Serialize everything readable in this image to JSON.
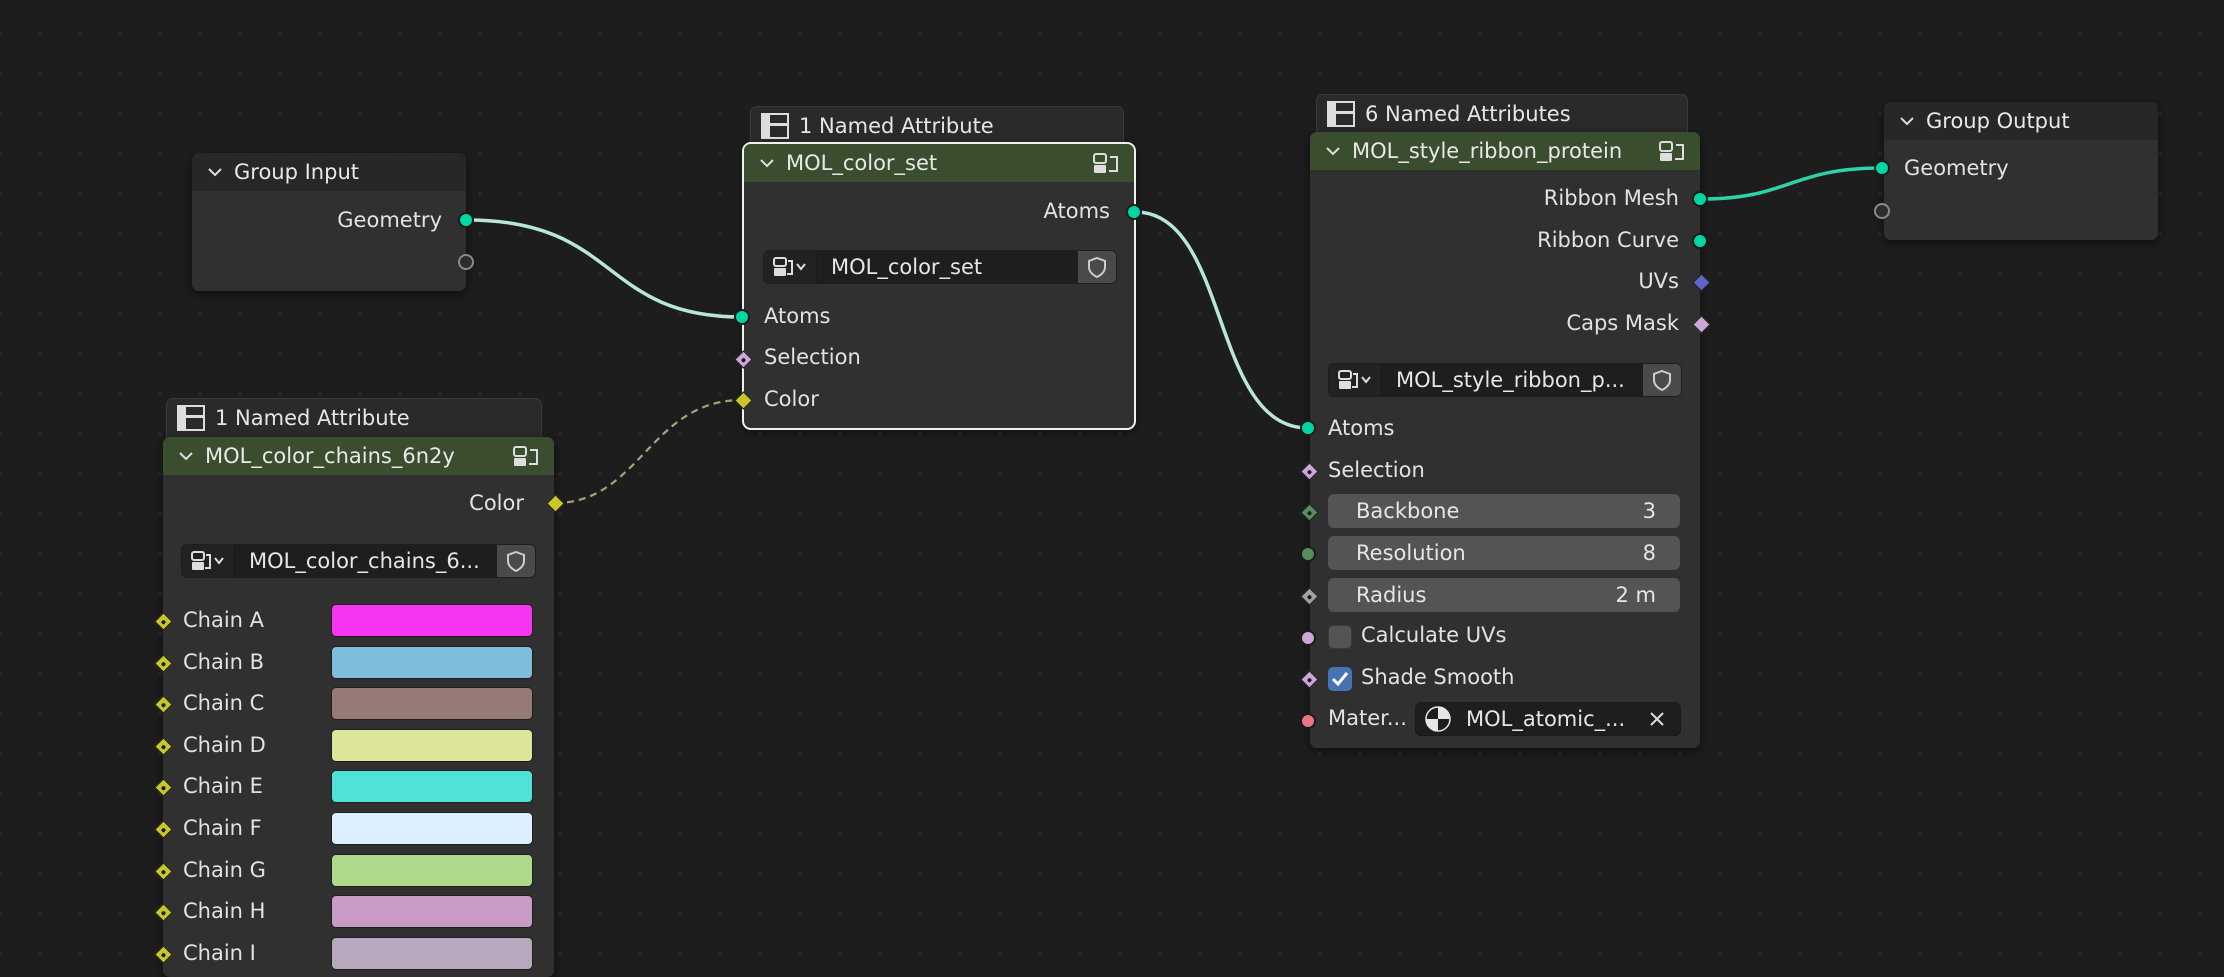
{
  "colors": {
    "background": "#1d1d1d",
    "node_body": "#303030",
    "header_green": "#3a4d2e",
    "geometry_socket": "#00d6a3",
    "color_socket": "#c7c729",
    "boolean_socket": "#cca6d6",
    "vector_socket": "#6363c7",
    "int_socket": "#598c5c",
    "float_socket": "#a1a1a1",
    "material_socket": "#eb7582",
    "checkbox_on": "#4772b3"
  },
  "group_input": {
    "title": "Group Input",
    "outputs": [
      "Geometry"
    ]
  },
  "group_output": {
    "title": "Group Output",
    "inputs": [
      "Geometry"
    ]
  },
  "color_set_frame": {
    "label": "1 Named Attribute"
  },
  "color_set": {
    "title": "MOL_color_set",
    "output": "Atoms",
    "selector_value": "MOL_color_set",
    "inputs": [
      "Atoms",
      "Selection",
      "Color"
    ]
  },
  "color_chains_frame": {
    "label": "1 Named Attribute"
  },
  "color_chains": {
    "title": "MOL_color_chains_6n2y",
    "output": "Color",
    "selector_value": "MOL_color_chains_6...",
    "chains": [
      {
        "label": "Chain A",
        "color": "#f635f2"
      },
      {
        "label": "Chain B",
        "color": "#7fbddc"
      },
      {
        "label": "Chain C",
        "color": "#957a77"
      },
      {
        "label": "Chain D",
        "color": "#dde599"
      },
      {
        "label": "Chain E",
        "color": "#4fe2d8"
      },
      {
        "label": "Chain F",
        "color": "#ddeeff"
      },
      {
        "label": "Chain G",
        "color": "#b0d88a"
      },
      {
        "label": "Chain H",
        "color": "#c99bc4"
      },
      {
        "label": "Chain I",
        "color": "#b9a8bd"
      }
    ]
  },
  "ribbon_frame": {
    "label": "6 Named Attributes"
  },
  "ribbon": {
    "title": "MOL_style_ribbon_protein",
    "outputs": [
      "Ribbon Mesh",
      "Ribbon Curve",
      "UVs",
      "Caps Mask"
    ],
    "selector_value": "MOL_style_ribbon_p...",
    "inputs": [
      "Atoms",
      "Selection"
    ],
    "backbone": {
      "label": "Backbone",
      "value": "3"
    },
    "resolution": {
      "label": "Resolution",
      "value": "8"
    },
    "radius": {
      "label": "Radius",
      "value": "2 m"
    },
    "calculate_uvs": {
      "label": "Calculate UVs",
      "checked": false
    },
    "shade_smooth": {
      "label": "Shade Smooth",
      "checked": true
    },
    "material": {
      "label": "Mater...",
      "value": "MOL_atomic_..."
    }
  }
}
